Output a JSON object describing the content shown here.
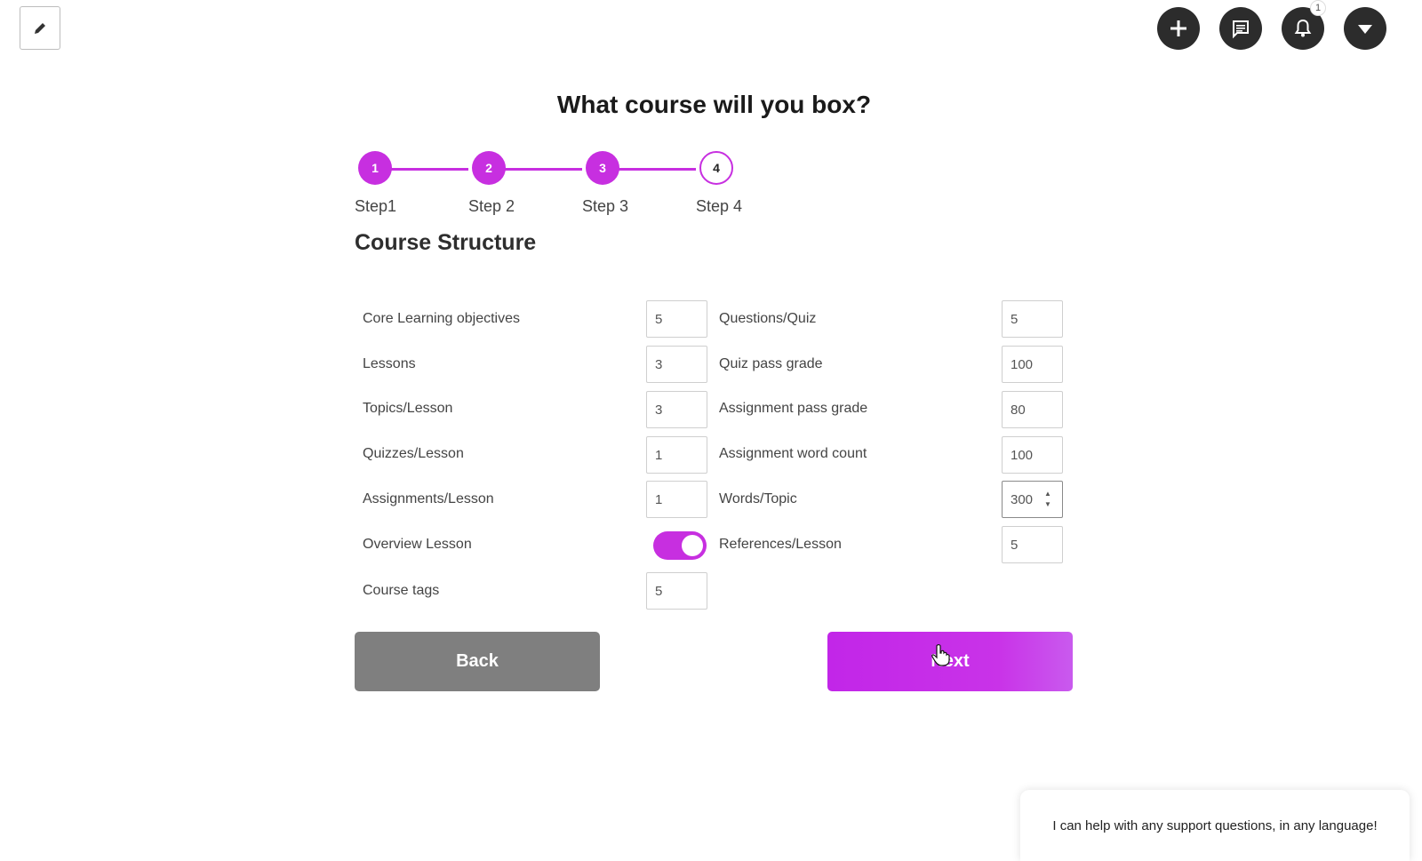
{
  "header": {
    "title": "What course will you box?",
    "notification_count": "1",
    "icons": [
      "pencil-icon",
      "plus-icon",
      "chat-icon",
      "bell-icon",
      "caret-down-icon"
    ]
  },
  "stepper": {
    "steps": [
      {
        "number": "1",
        "label": "Step1",
        "state": "done"
      },
      {
        "number": "2",
        "label": "Step 2",
        "state": "done"
      },
      {
        "number": "3",
        "label": "Step 3",
        "state": "done"
      },
      {
        "number": "4",
        "label": "Step 4",
        "state": "current"
      }
    ]
  },
  "section": {
    "title": "Course Structure"
  },
  "form": {
    "left": [
      {
        "label": "Core Learning objectives",
        "value": "5"
      },
      {
        "label": "Lessons",
        "value": "3"
      },
      {
        "label": "Topics/Lesson",
        "value": "3"
      },
      {
        "label": "Quizzes/Lesson",
        "value": "1"
      },
      {
        "label": "Assignments/Lesson",
        "value": "1"
      },
      {
        "label": "Overview Lesson",
        "toggle": true
      },
      {
        "label": "Course tags",
        "value": "5"
      }
    ],
    "right": [
      {
        "label": "Questions/Quiz",
        "value": "5"
      },
      {
        "label": "Quiz pass grade",
        "value": "100"
      },
      {
        "label": "Assignment pass grade",
        "value": "80"
      },
      {
        "label": "Assignment word count",
        "value": "100"
      },
      {
        "label": "Words/Topic",
        "value": "300"
      },
      {
        "label": "References/Lesson",
        "value": "5"
      }
    ]
  },
  "buttons": {
    "back_label": "Back",
    "next_label": "Next"
  },
  "chat": {
    "message": "I can help with any support questions, in any language!"
  },
  "colors": {
    "accent": "#c72fe0",
    "back_button": "#7f7f7f",
    "dark_icon": "#2c2c2c"
  }
}
